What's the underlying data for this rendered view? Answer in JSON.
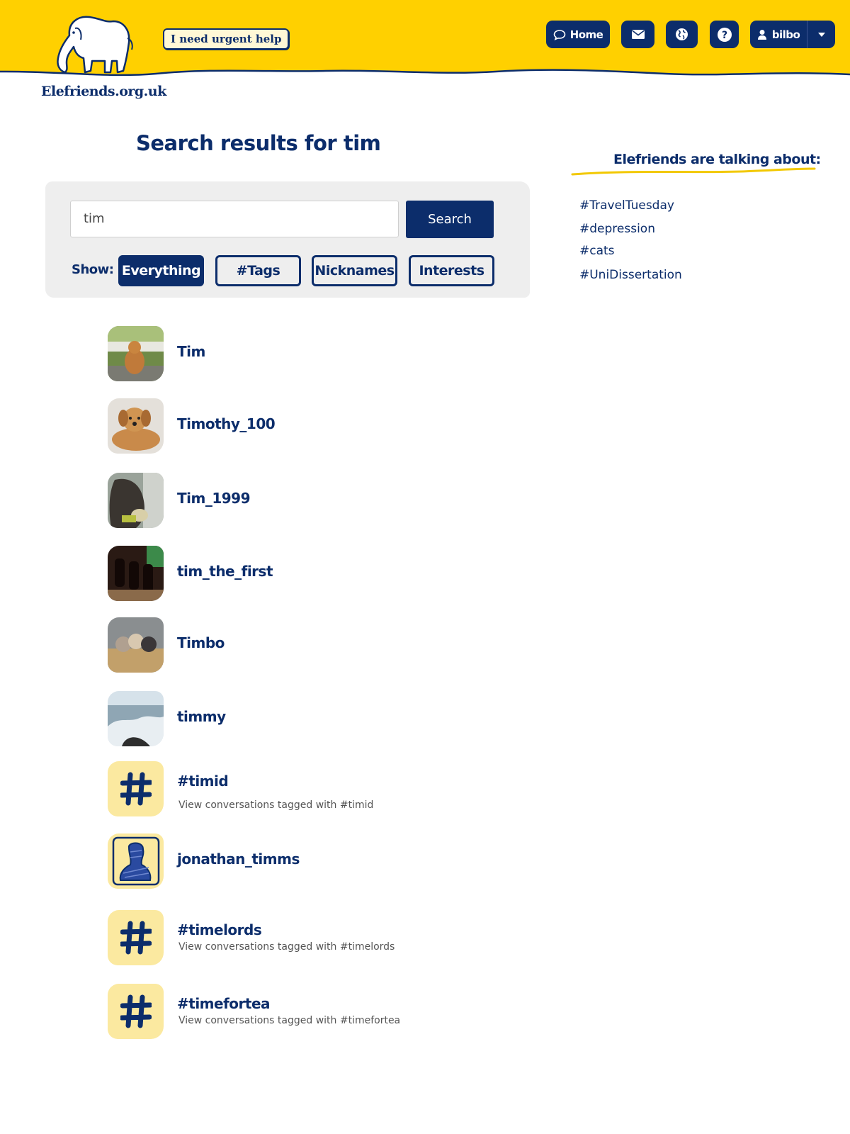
{
  "header": {
    "site_name": "Elefriends.org.uk",
    "urgent_help": "I need urgent help",
    "nav": {
      "home": "Home",
      "mail_icon": "envelope-icon",
      "globe_icon": "globe-icon",
      "help_icon": "question-icon",
      "user": "bilbo"
    },
    "colors": {
      "banner": "#ffd000",
      "brand": "#0c2d6b"
    }
  },
  "search": {
    "title": "Search results for tim",
    "query": "tim",
    "button": "Search",
    "show_label": "Show:",
    "filters": [
      {
        "label": "Everything",
        "active": true
      },
      {
        "label": "#Tags",
        "active": false
      },
      {
        "label": "Nicknames",
        "active": false
      },
      {
        "label": "Interests",
        "active": false
      }
    ]
  },
  "results": [
    {
      "name": "Tim",
      "type": "user"
    },
    {
      "name": "Timothy_100",
      "type": "user"
    },
    {
      "name": "Tim_1999",
      "type": "user"
    },
    {
      "name": "tim_the_first",
      "type": "user"
    },
    {
      "name": "Timbo",
      "type": "user"
    },
    {
      "name": "timmy",
      "type": "user"
    },
    {
      "name": "#timid",
      "type": "tag",
      "sub": "View conversations tagged with #timid"
    },
    {
      "name": "jonathan_timms",
      "type": "user"
    },
    {
      "name": "#timelords",
      "type": "tag",
      "sub": "View conversations tagged with #timelords"
    },
    {
      "name": "#timefortea",
      "type": "tag",
      "sub": "View conversations tagged with #timefortea"
    }
  ],
  "sidebar": {
    "title": "Elefriends are talking about:",
    "tags": [
      "#TravelTuesday",
      "#depression",
      "#cats",
      "#UniDissertation"
    ]
  }
}
